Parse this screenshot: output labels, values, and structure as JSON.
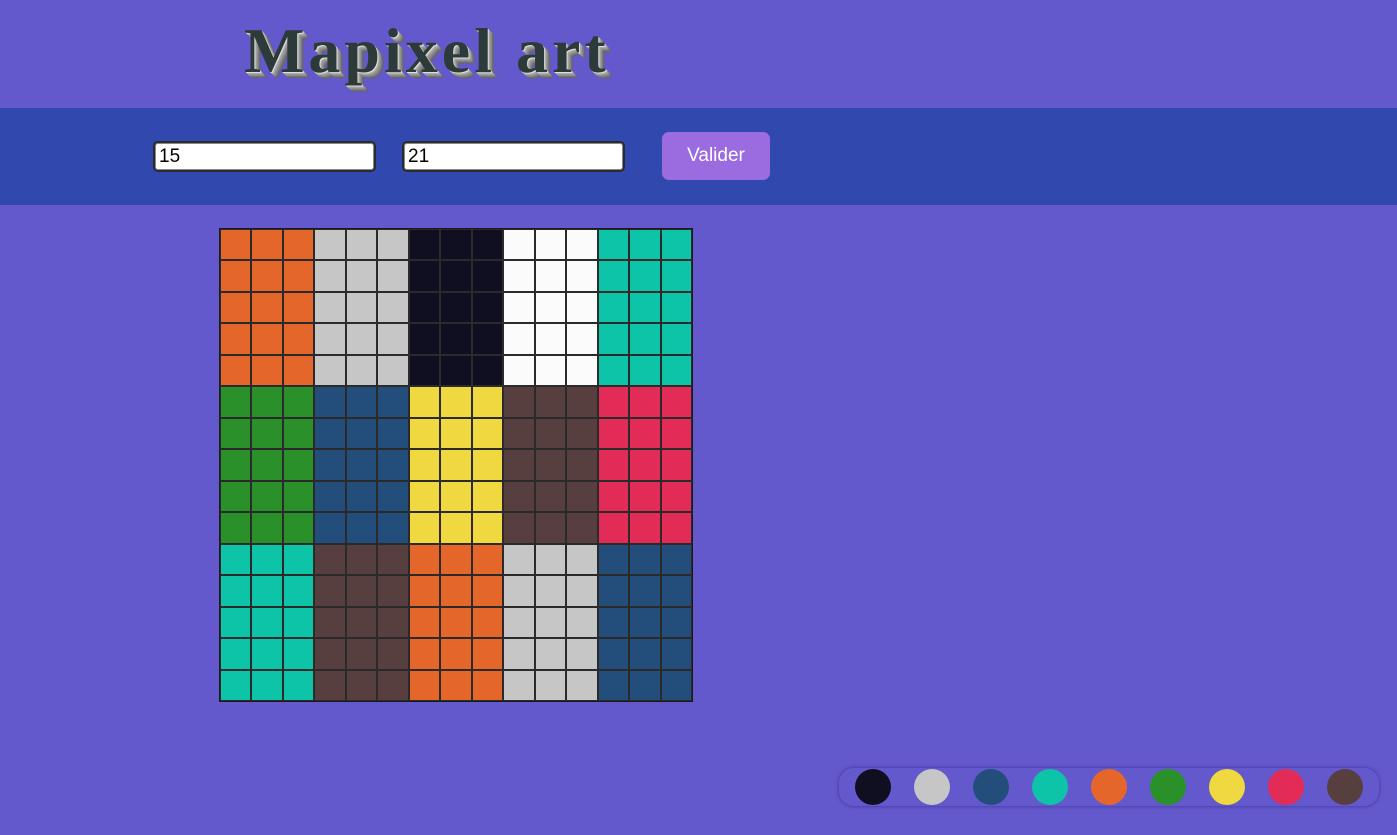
{
  "header": {
    "title": "Mapixel art"
  },
  "form": {
    "rows_value": "15",
    "cols_value": "21",
    "submit_label": "Valider"
  },
  "colors": {
    "background": "#6459cc",
    "form_bar": "#3149ae",
    "button": "#9b6be0"
  },
  "grid": {
    "rows": 15,
    "cols": 15,
    "block_rows": [
      [
        "#e5662a",
        "#c6c6c6",
        "#100f21",
        "#fbfbfb",
        "#0dc4a8"
      ],
      [
        "#2a902a",
        "#234e7b",
        "#efd840",
        "#583f3f",
        "#e22c57"
      ],
      [
        "#0dc4a8",
        "#583f3f",
        "#e5662a",
        "#c6c6c6",
        "#234e7b"
      ]
    ]
  },
  "palette": [
    {
      "name": "black",
      "color": "#100f21"
    },
    {
      "name": "silver",
      "color": "#c6c6c6"
    },
    {
      "name": "navy",
      "color": "#234e7b"
    },
    {
      "name": "teal",
      "color": "#0dc4a8"
    },
    {
      "name": "orange",
      "color": "#e5662a"
    },
    {
      "name": "green",
      "color": "#2a902a"
    },
    {
      "name": "yellow",
      "color": "#efd840"
    },
    {
      "name": "red",
      "color": "#e22c57"
    },
    {
      "name": "brown",
      "color": "#583f3f"
    }
  ]
}
